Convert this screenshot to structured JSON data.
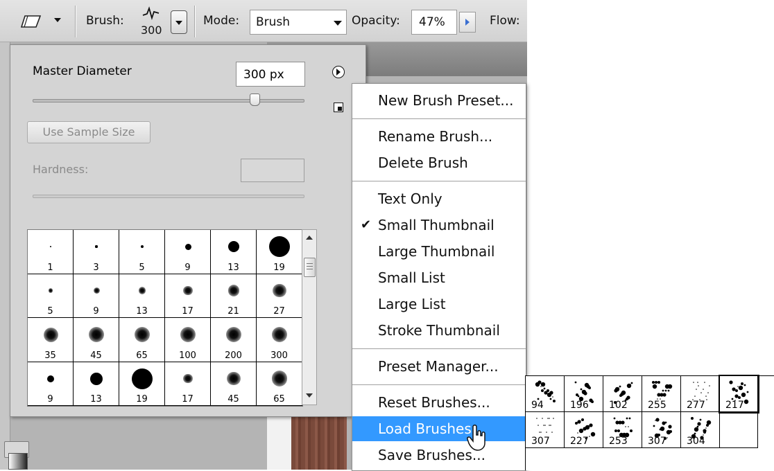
{
  "options_bar": {
    "brush_label": "Brush:",
    "brush_size": "300",
    "mode_label": "Mode:",
    "mode_value": "Brush",
    "opacity_label": "Opacity:",
    "opacity_value": "47%",
    "flow_label": "Flow:"
  },
  "picker": {
    "master_diameter_label": "Master Diameter",
    "master_diameter_value": "300 px",
    "diameter_slider_level": 0.82,
    "use_sample_size_label": "Use Sample Size",
    "hardness_label": "Hardness:",
    "hardness_value": ""
  },
  "presets": [
    {
      "size": "1",
      "r": 1.2,
      "blur": 0
    },
    {
      "size": "3",
      "r": 1.6,
      "blur": 0
    },
    {
      "size": "5",
      "r": 2.2,
      "blur": 0
    },
    {
      "size": "9",
      "r": 4.5,
      "blur": 0
    },
    {
      "size": "13",
      "r": 8,
      "blur": 0
    },
    {
      "size": "19",
      "r": 15,
      "blur": 0
    },
    {
      "size": "5",
      "r": 2.2,
      "blur": 1
    },
    {
      "size": "9",
      "r": 3,
      "blur": 1
    },
    {
      "size": "13",
      "r": 3.6,
      "blur": 1
    },
    {
      "size": "17",
      "r": 4.5,
      "blur": 1
    },
    {
      "size": "21",
      "r": 5.5,
      "blur": 1
    },
    {
      "size": "27",
      "r": 6.5,
      "blur": 1
    },
    {
      "size": "35",
      "r": 7,
      "blur": 1
    },
    {
      "size": "45",
      "r": 7.5,
      "blur": 1
    },
    {
      "size": "65",
      "r": 7.5,
      "blur": 1
    },
    {
      "size": "100",
      "r": 7.5,
      "blur": 1
    },
    {
      "size": "200",
      "r": 7.5,
      "blur": 1
    },
    {
      "size": "300",
      "r": 7.5,
      "blur": 1
    },
    {
      "size": "9",
      "r": 5,
      "blur": 0
    },
    {
      "size": "13",
      "r": 9,
      "blur": 0
    },
    {
      "size": "19",
      "r": 15,
      "blur": 0
    },
    {
      "size": "17",
      "r": 4.5,
      "blur": 1
    },
    {
      "size": "45",
      "r": 6.5,
      "blur": 1
    },
    {
      "size": "65",
      "r": 7.5,
      "blur": 1
    }
  ],
  "menu": {
    "groups": [
      [
        {
          "label": "New Brush Preset...",
          "checked": false
        }
      ],
      [
        {
          "label": "Rename Brush...",
          "checked": false
        },
        {
          "label": "Delete Brush",
          "checked": false
        }
      ],
      [
        {
          "label": "Text Only",
          "checked": false
        },
        {
          "label": "Small Thumbnail",
          "checked": true
        },
        {
          "label": "Large Thumbnail",
          "checked": false
        },
        {
          "label": "Small List",
          "checked": false
        },
        {
          "label": "Large List",
          "checked": false
        },
        {
          "label": "Stroke Thumbnail",
          "checked": false
        }
      ],
      [
        {
          "label": "Preset Manager...",
          "checked": false
        }
      ],
      [
        {
          "label": "Reset Brushes...",
          "checked": false
        },
        {
          "label": "Load Brushes...",
          "checked": false,
          "highlighted": true
        },
        {
          "label": "Save Brushes...",
          "checked": false
        }
      ]
    ],
    "check_glyph": "✔"
  },
  "splatter_presets": {
    "rows": [
      [
        "94",
        "196",
        "102",
        "255",
        "277",
        "217"
      ],
      [
        "307",
        "227",
        "253",
        "307",
        "304",
        ""
      ]
    ],
    "selected_index": 5
  },
  "icons": {
    "eraser": "eraser-icon",
    "brush_tip": "brush-tip-icon",
    "flyout": "flyout-arrow-icon",
    "new_preset": "new-preset-icon",
    "cursor": "hand-cursor-icon"
  }
}
